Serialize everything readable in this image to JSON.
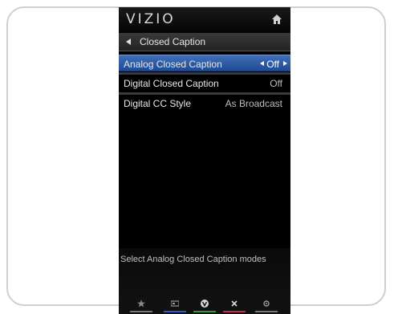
{
  "header": {
    "logo": "VIZIO"
  },
  "menu": {
    "title": "Closed Caption",
    "items": [
      {
        "label": "Analog Closed Caption",
        "value": "Off",
        "selected": true
      },
      {
        "label": "Digital Closed Caption",
        "value": "Off",
        "selected": false
      },
      {
        "label": "Digital CC Style",
        "value": "As Broadcast",
        "selected": false
      }
    ]
  },
  "help": {
    "text": "Select Analog Closed Caption modes"
  },
  "footer": {
    "buttons": [
      {
        "icon": "star-icon",
        "color": "#777777"
      },
      {
        "icon": "widget-icon",
        "color": "#2f5db8"
      },
      {
        "icon": "vizio-v-icon",
        "color": "#2f9a3a"
      },
      {
        "icon": "close-icon",
        "color": "#c0304a"
      },
      {
        "icon": "gear-icon",
        "color": "#777777"
      }
    ]
  },
  "colors": {
    "highlight": "#2c5aa6",
    "background": "#000000"
  }
}
